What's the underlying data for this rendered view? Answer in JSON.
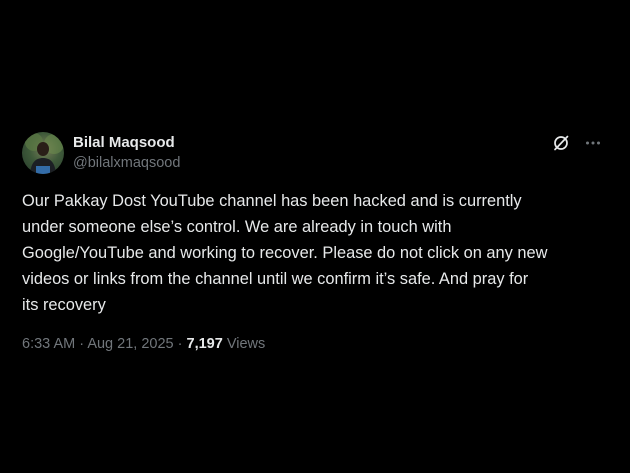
{
  "author": {
    "display_name": "Bilal Maqsood",
    "handle": "@bilalxmaqsood"
  },
  "header_icons": [
    "grok-icon",
    "more-icon"
  ],
  "tweet": {
    "text": "Our Pakkay Dost YouTube channel has been hacked and is currently\nunder someone else’s control. We are already in touch with\nGoogle/YouTube and working to recover. Please do not click on any new\nvideos or links from the channel until we confirm it’s safe. And pray for\nits recovery",
    "time": "6:33 AM",
    "separator": "·",
    "date": "Aug 21, 2025",
    "views_count": "7,197",
    "views_label": "Views"
  },
  "colors": {
    "background": "#000000",
    "text": "#e7e9ea",
    "secondary": "#71767b"
  }
}
